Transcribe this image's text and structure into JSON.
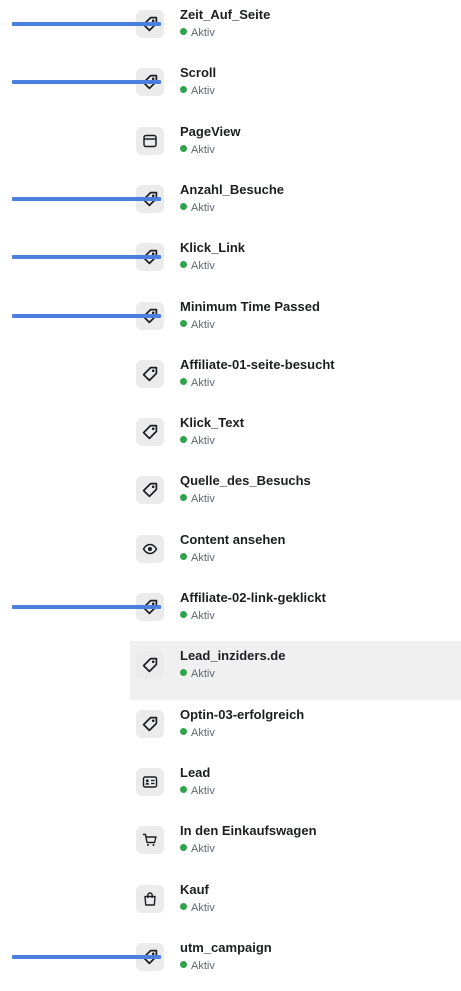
{
  "events": [
    {
      "name": "Zeit_Auf_Seite",
      "status": "Aktiv",
      "icon": "tag-icon",
      "marked": true,
      "selected": false
    },
    {
      "name": "Scroll",
      "status": "Aktiv",
      "icon": "tag-icon",
      "marked": true,
      "selected": false
    },
    {
      "name": "PageView",
      "status": "Aktiv",
      "icon": "browser-window-icon",
      "marked": false,
      "selected": false
    },
    {
      "name": "Anzahl_Besuche",
      "status": "Aktiv",
      "icon": "tag-icon",
      "marked": true,
      "selected": false
    },
    {
      "name": "Klick_Link",
      "status": "Aktiv",
      "icon": "tag-icon",
      "marked": true,
      "selected": false
    },
    {
      "name": "Minimum Time Passed",
      "status": "Aktiv",
      "icon": "tag-icon",
      "marked": true,
      "selected": false
    },
    {
      "name": "Affiliate-01-seite-besucht",
      "status": "Aktiv",
      "icon": "tag-icon",
      "marked": false,
      "selected": false
    },
    {
      "name": "Klick_Text",
      "status": "Aktiv",
      "icon": "tag-icon",
      "marked": false,
      "selected": false
    },
    {
      "name": "Quelle_des_Besuchs",
      "status": "Aktiv",
      "icon": "tag-icon",
      "marked": false,
      "selected": false
    },
    {
      "name": "Content ansehen",
      "status": "Aktiv",
      "icon": "eye-icon",
      "marked": false,
      "selected": false
    },
    {
      "name": "Affiliate-02-link-geklickt",
      "status": "Aktiv",
      "icon": "tag-icon",
      "marked": true,
      "selected": false
    },
    {
      "name": "Lead_inziders.de",
      "status": "Aktiv",
      "icon": "tag-icon",
      "marked": false,
      "selected": true
    },
    {
      "name": "Optin-03-erfolgreich",
      "status": "Aktiv",
      "icon": "tag-icon",
      "marked": false,
      "selected": false
    },
    {
      "name": "Lead",
      "status": "Aktiv",
      "icon": "contact-card-icon",
      "marked": false,
      "selected": false
    },
    {
      "name": "In den Einkaufswagen",
      "status": "Aktiv",
      "icon": "shopping-cart-icon",
      "marked": false,
      "selected": false
    },
    {
      "name": "Kauf",
      "status": "Aktiv",
      "icon": "shopping-bag-icon",
      "marked": false,
      "selected": false
    },
    {
      "name": "utm_campaign",
      "status": "Aktiv",
      "icon": "tag-icon",
      "marked": true,
      "selected": false
    }
  ],
  "colors": {
    "status_active": "#31a24c",
    "annotation": "#4a7fe0",
    "selected_row": "#f0f0f0",
    "icon_box": "#ebebeb"
  }
}
